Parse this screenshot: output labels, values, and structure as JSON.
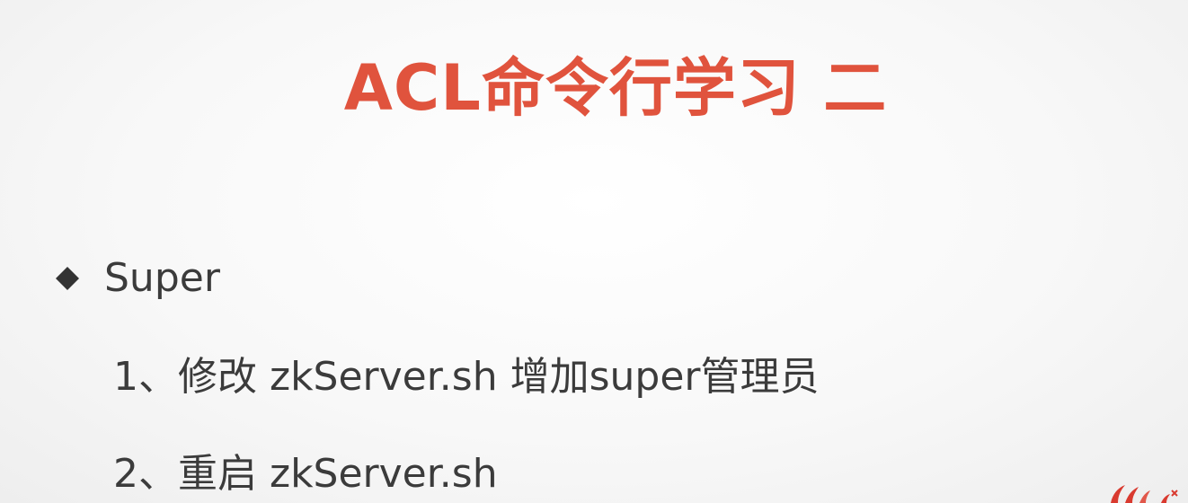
{
  "slide": {
    "title": "ACL命令行学习 二",
    "bullet": {
      "icon": "diamond-bullet-icon",
      "label": "Super"
    },
    "steps": [
      "1、修改 zkServer.sh 增加super管理员",
      "2、重启 zkServer.sh"
    ],
    "colors": {
      "title": "#e0533d",
      "body_text": "#3b3b3b",
      "logo": "#d93a2f"
    }
  }
}
